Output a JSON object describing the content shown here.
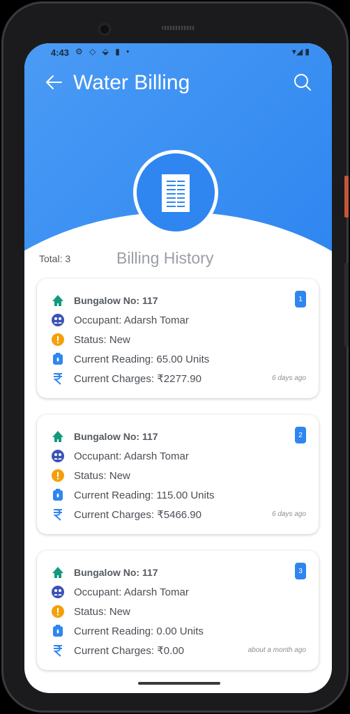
{
  "statusbar": {
    "time": "4:43"
  },
  "appbar": {
    "title": "Water Billing",
    "back_icon": "arrow-left-icon",
    "search_icon": "search-icon"
  },
  "summary": {
    "total_label": "Total: 3",
    "section_title": "Billing History"
  },
  "colors": {
    "primary": "#2f86f0",
    "house": "#139a7c",
    "occupant": "#3d52b5",
    "status": "#f5a00a",
    "reading": "#2f86f0",
    "charges": "#2f86f0"
  },
  "bills": [
    {
      "badge": "1",
      "bungalow": "Bungalow No: 117",
      "occupant": "Occupant: Adarsh Tomar",
      "status": "Status: New",
      "reading": "Current Reading: 65.00 Units",
      "charges": "Current Charges: ₹2277.90",
      "time": "6 days ago"
    },
    {
      "badge": "2",
      "bungalow": "Bungalow No: 117",
      "occupant": "Occupant: Adarsh Tomar",
      "status": "Status: New",
      "reading": "Current Reading: 115.00 Units",
      "charges": "Current Charges: ₹5466.90",
      "time": "6 days ago"
    },
    {
      "badge": "3",
      "bungalow": "Bungalow No: 117",
      "occupant": "Occupant: Adarsh Tomar",
      "status": "Status: New",
      "reading": "Current Reading: 0.00 Units",
      "charges": "Current Charges: ₹0.00",
      "time": "about a month ago"
    }
  ]
}
